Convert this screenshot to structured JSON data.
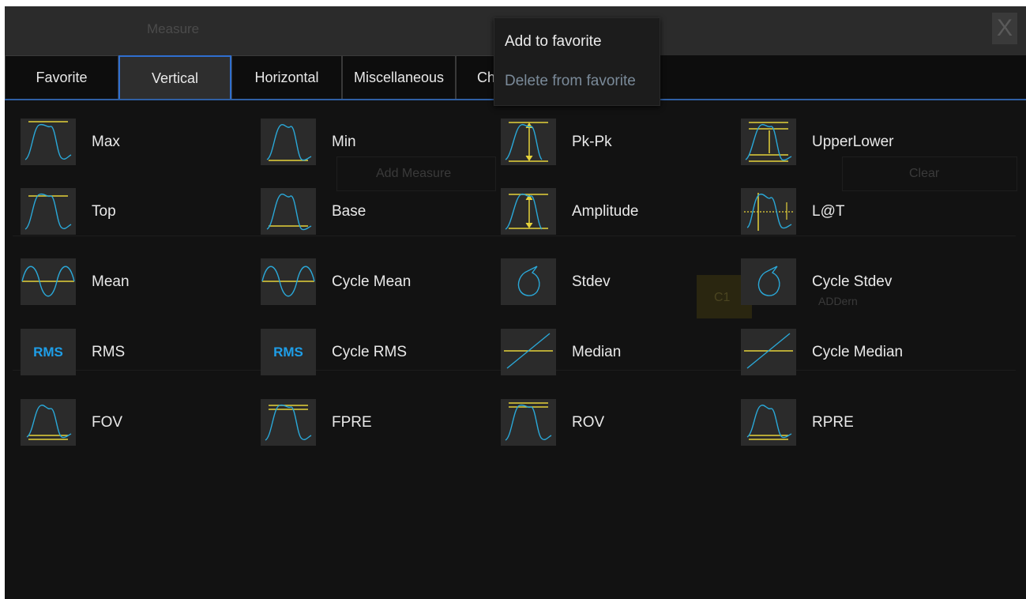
{
  "dialog": {
    "title": "Measure",
    "close_glyph": "X"
  },
  "background_ghost": {
    "add_measure": "Add Measure",
    "clear": "Clear",
    "ch_label": "C1",
    "open_label": "ADDern"
  },
  "tabs": [
    {
      "label": "Favorite"
    },
    {
      "label": "Vertical"
    },
    {
      "label": "Horizontal"
    },
    {
      "label": "Miscellaneous"
    },
    {
      "label": "Ch"
    }
  ],
  "active_tab": "Vertical",
  "items": [
    {
      "label": "Max",
      "icon": "max-icon"
    },
    {
      "label": "Min",
      "icon": "min-icon"
    },
    {
      "label": "Pk-Pk",
      "icon": "pk-pk-icon"
    },
    {
      "label": "UpperLower",
      "icon": "upper-lower-icon"
    },
    {
      "label": "Top",
      "icon": "top-icon"
    },
    {
      "label": "Base",
      "icon": "base-icon"
    },
    {
      "label": "Amplitude",
      "icon": "amplitude-icon"
    },
    {
      "label": "L@T",
      "icon": "level-at-trigger-icon"
    },
    {
      "label": "Mean",
      "icon": "mean-icon"
    },
    {
      "label": "Cycle Mean",
      "icon": "cycle-mean-icon"
    },
    {
      "label": "Stdev",
      "icon": "stdev-icon"
    },
    {
      "label": "Cycle Stdev",
      "icon": "cycle-stdev-icon"
    },
    {
      "label": "RMS",
      "icon": "rms-icon",
      "icon_text": "RMS"
    },
    {
      "label": "Cycle RMS",
      "icon": "cycle-rms-icon",
      "icon_text": "RMS"
    },
    {
      "label": "Median",
      "icon": "median-icon"
    },
    {
      "label": "Cycle Median",
      "icon": "cycle-median-icon"
    },
    {
      "label": "FOV",
      "icon": "fov-icon"
    },
    {
      "label": "FPRE",
      "icon": "fpre-icon"
    },
    {
      "label": "ROV",
      "icon": "rov-icon"
    },
    {
      "label": "RPRE",
      "icon": "rpre-icon"
    }
  ],
  "context_menu": {
    "add_to_favorite": "Add to favorite",
    "delete_from_favorite": "Delete from favorite"
  },
  "colors": {
    "trace": "#2aa8d8",
    "marker": "#e5d23a",
    "accent": "#2f6fd0",
    "rms_text": "#1e9ee8",
    "disabled_text": "#7a8a99"
  }
}
